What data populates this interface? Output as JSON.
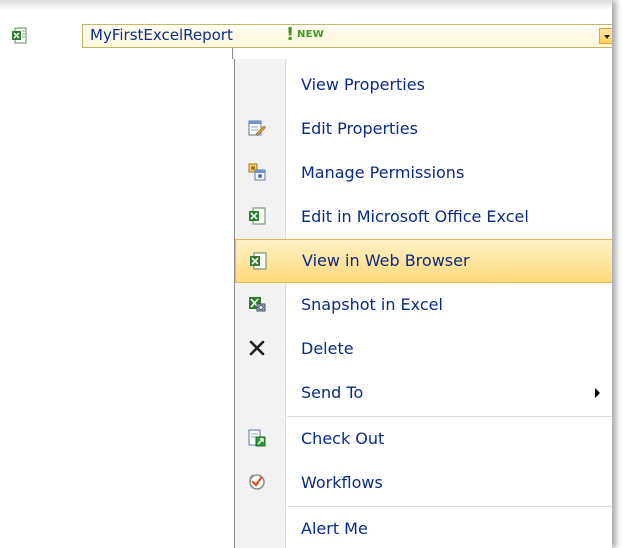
{
  "document": {
    "title": "MyFirstExcelReport",
    "new_mark": "!",
    "new_badge": "NEW"
  },
  "menu": {
    "items": [
      {
        "label": "View Properties",
        "icon": "none"
      },
      {
        "label": "Edit Properties",
        "icon": "edit-properties-icon"
      },
      {
        "label": "Manage Permissions",
        "icon": "manage-permissions-icon"
      },
      {
        "label": "Edit in Microsoft Office Excel",
        "icon": "excel-icon"
      },
      {
        "label": "View in Web Browser",
        "icon": "excel-web-icon",
        "highlighted": true
      },
      {
        "label": "Snapshot in Excel",
        "icon": "snapshot-icon"
      },
      {
        "label": "Delete",
        "icon": "delete-icon"
      },
      {
        "label": "Send To",
        "icon": "none",
        "has_submenu": true
      },
      {
        "label": "Check Out",
        "icon": "check-out-icon"
      },
      {
        "label": "Workflows",
        "icon": "workflows-icon"
      },
      {
        "label": "Alert Me",
        "icon": "none"
      }
    ]
  },
  "colors": {
    "link_text": "#0a2a84",
    "highlight": "#ffd97d",
    "new_green": "#3c9a21"
  }
}
